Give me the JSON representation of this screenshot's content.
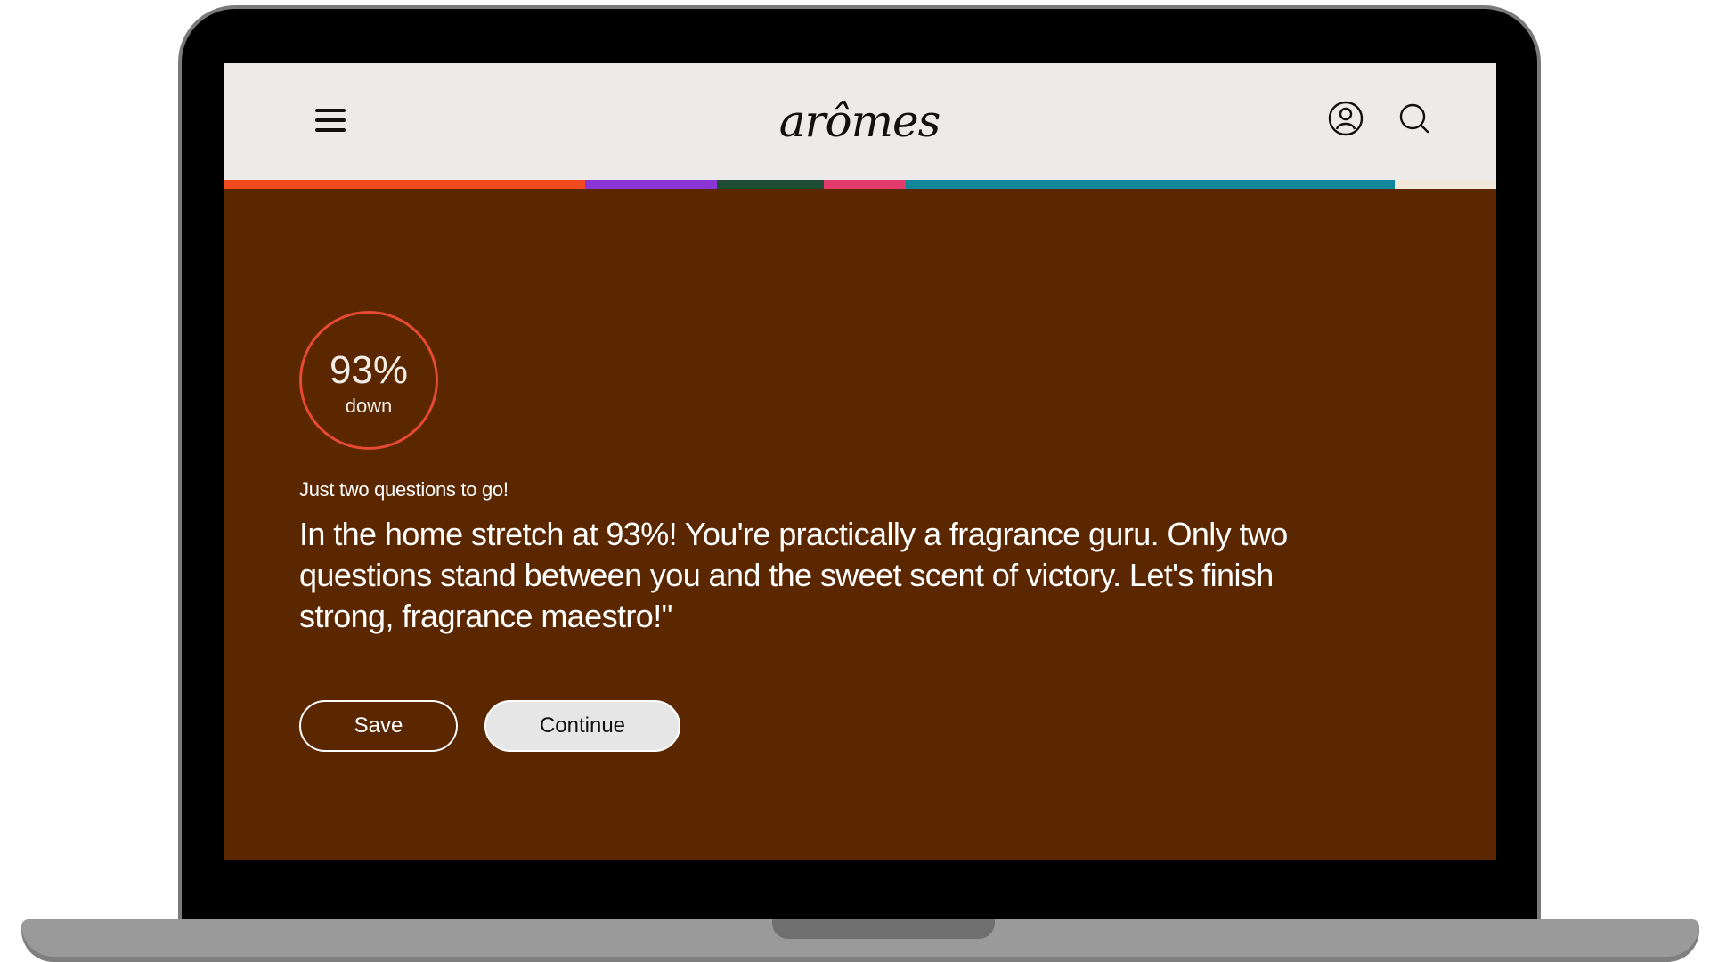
{
  "header": {
    "logo_text": "arômes",
    "menu_icon": "hamburger-menu-icon",
    "profile_icon": "user-profile-icon",
    "search_icon": "search-icon"
  },
  "progress_strip": {
    "segments": [
      {
        "color": "#f04a1e",
        "fraction": 0.284
      },
      {
        "color": "#8a35d6",
        "fraction": 0.104
      },
      {
        "color": "#1f4d33",
        "fraction": 0.084
      },
      {
        "color": "#e23b6b",
        "fraction": 0.064
      },
      {
        "color": "#12869a",
        "fraction": 0.384
      },
      {
        "color": "#f1e7db",
        "fraction": 0.08
      }
    ]
  },
  "quiz": {
    "score_value": "93%",
    "score_caption": "down",
    "subheading": "Just two questions to go!",
    "message": "In the home stretch at 93%! You're practically a fragrance guru. Only two questions stand between you and the sweet scent of victory. Let's finish strong, fragrance maestro!\"",
    "save_label": "Save",
    "continue_label": "Continue"
  },
  "colors": {
    "page_background": "#5a2700",
    "header_background": "#ecebe9",
    "ring_accent": "#e74a32"
  }
}
